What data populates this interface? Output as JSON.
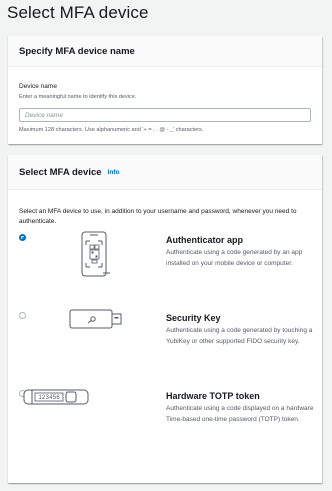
{
  "page": {
    "title": "Select MFA device"
  },
  "device_name_panel": {
    "header": "Specify MFA device name",
    "label": "Device name",
    "description": "Enter a meaningful name to identify this device.",
    "placeholder": "Device name",
    "value": "",
    "constraint": "Maximum 128 characters. Use alphanumeric and '+ = , . @ - _' characters."
  },
  "device_panel": {
    "header": "Select MFA device",
    "info_label": "Info",
    "intro": "Select an MFA device to use, in addition to your username and password, whenever you need to authenticate.",
    "options": [
      {
        "title": "Authenticator app",
        "description": "Authenticate using a code generated by an app installed on your mobile device or computer.",
        "selected": true,
        "icon": "mobile-qr-icon"
      },
      {
        "title": "Security Key",
        "description": "Authenticate using a code generated by touching a YubiKey or other supported FIDO security key.",
        "selected": false,
        "icon": "usb-security-key-icon"
      },
      {
        "title": "Hardware TOTP token",
        "description": "Authenticate using a code displayed on a hardware Time-based one-time password (TOTP) token.",
        "selected": false,
        "icon": "hardware-token-icon",
        "token_display": "123456"
      }
    ]
  },
  "colors": {
    "accent": "#0073bb",
    "background": "#f2f3f3",
    "panel_header": "#fafafa"
  }
}
